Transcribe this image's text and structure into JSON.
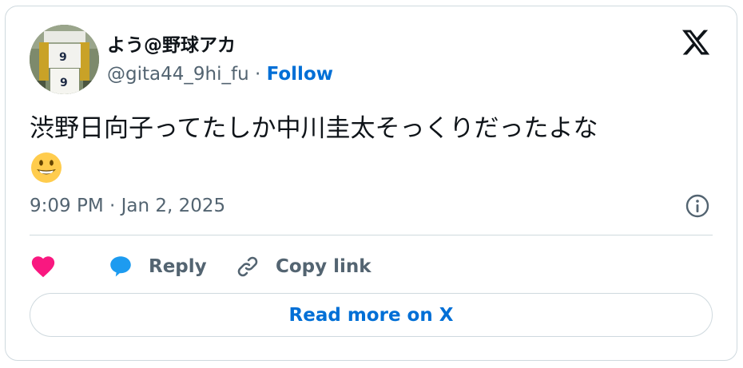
{
  "author": {
    "display_name": "よう@野球アカ",
    "handle": "@gita44_9hi_fu",
    "separator": " · ",
    "follow_label": "Follow",
    "avatar_icon": "avatar-photo"
  },
  "tweet": {
    "text": "渋野日向子ってたしか中川圭太そっくりだったよな",
    "emoji": "grinning-face-emoji",
    "timestamp": "9:09 PM · Jan 2, 2025"
  },
  "actions": {
    "like_icon": "heart-icon",
    "reply_label": "Reply",
    "copy_link_label": "Copy link"
  },
  "footer": {
    "read_more_label": "Read more on X"
  },
  "colors": {
    "accent": "#006fd6",
    "like": "#f91880",
    "reply": "#1d9bf0",
    "secondary_text": "#536471",
    "border": "#cfd9de"
  }
}
